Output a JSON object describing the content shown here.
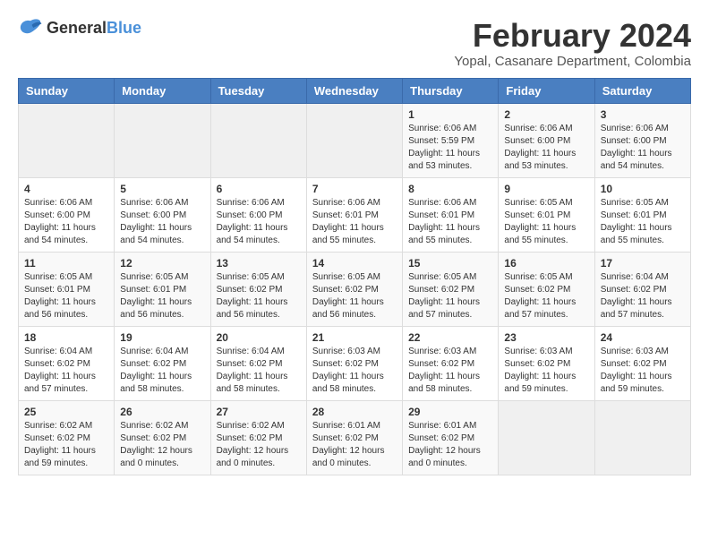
{
  "header": {
    "logo_general": "General",
    "logo_blue": "Blue",
    "month_year": "February 2024",
    "location": "Yopal, Casanare Department, Colombia"
  },
  "calendar": {
    "days_of_week": [
      "Sunday",
      "Monday",
      "Tuesday",
      "Wednesday",
      "Thursday",
      "Friday",
      "Saturday"
    ],
    "weeks": [
      [
        {
          "day": "",
          "info": ""
        },
        {
          "day": "",
          "info": ""
        },
        {
          "day": "",
          "info": ""
        },
        {
          "day": "",
          "info": ""
        },
        {
          "day": "1",
          "info": "Sunrise: 6:06 AM\nSunset: 5:59 PM\nDaylight: 11 hours and 53 minutes."
        },
        {
          "day": "2",
          "info": "Sunrise: 6:06 AM\nSunset: 6:00 PM\nDaylight: 11 hours and 53 minutes."
        },
        {
          "day": "3",
          "info": "Sunrise: 6:06 AM\nSunset: 6:00 PM\nDaylight: 11 hours and 54 minutes."
        }
      ],
      [
        {
          "day": "4",
          "info": "Sunrise: 6:06 AM\nSunset: 6:00 PM\nDaylight: 11 hours and 54 minutes."
        },
        {
          "day": "5",
          "info": "Sunrise: 6:06 AM\nSunset: 6:00 PM\nDaylight: 11 hours and 54 minutes."
        },
        {
          "day": "6",
          "info": "Sunrise: 6:06 AM\nSunset: 6:00 PM\nDaylight: 11 hours and 54 minutes."
        },
        {
          "day": "7",
          "info": "Sunrise: 6:06 AM\nSunset: 6:01 PM\nDaylight: 11 hours and 55 minutes."
        },
        {
          "day": "8",
          "info": "Sunrise: 6:06 AM\nSunset: 6:01 PM\nDaylight: 11 hours and 55 minutes."
        },
        {
          "day": "9",
          "info": "Sunrise: 6:05 AM\nSunset: 6:01 PM\nDaylight: 11 hours and 55 minutes."
        },
        {
          "day": "10",
          "info": "Sunrise: 6:05 AM\nSunset: 6:01 PM\nDaylight: 11 hours and 55 minutes."
        }
      ],
      [
        {
          "day": "11",
          "info": "Sunrise: 6:05 AM\nSunset: 6:01 PM\nDaylight: 11 hours and 56 minutes."
        },
        {
          "day": "12",
          "info": "Sunrise: 6:05 AM\nSunset: 6:01 PM\nDaylight: 11 hours and 56 minutes."
        },
        {
          "day": "13",
          "info": "Sunrise: 6:05 AM\nSunset: 6:02 PM\nDaylight: 11 hours and 56 minutes."
        },
        {
          "day": "14",
          "info": "Sunrise: 6:05 AM\nSunset: 6:02 PM\nDaylight: 11 hours and 56 minutes."
        },
        {
          "day": "15",
          "info": "Sunrise: 6:05 AM\nSunset: 6:02 PM\nDaylight: 11 hours and 57 minutes."
        },
        {
          "day": "16",
          "info": "Sunrise: 6:05 AM\nSunset: 6:02 PM\nDaylight: 11 hours and 57 minutes."
        },
        {
          "day": "17",
          "info": "Sunrise: 6:04 AM\nSunset: 6:02 PM\nDaylight: 11 hours and 57 minutes."
        }
      ],
      [
        {
          "day": "18",
          "info": "Sunrise: 6:04 AM\nSunset: 6:02 PM\nDaylight: 11 hours and 57 minutes."
        },
        {
          "day": "19",
          "info": "Sunrise: 6:04 AM\nSunset: 6:02 PM\nDaylight: 11 hours and 58 minutes."
        },
        {
          "day": "20",
          "info": "Sunrise: 6:04 AM\nSunset: 6:02 PM\nDaylight: 11 hours and 58 minutes."
        },
        {
          "day": "21",
          "info": "Sunrise: 6:03 AM\nSunset: 6:02 PM\nDaylight: 11 hours and 58 minutes."
        },
        {
          "day": "22",
          "info": "Sunrise: 6:03 AM\nSunset: 6:02 PM\nDaylight: 11 hours and 58 minutes."
        },
        {
          "day": "23",
          "info": "Sunrise: 6:03 AM\nSunset: 6:02 PM\nDaylight: 11 hours and 59 minutes."
        },
        {
          "day": "24",
          "info": "Sunrise: 6:03 AM\nSunset: 6:02 PM\nDaylight: 11 hours and 59 minutes."
        }
      ],
      [
        {
          "day": "25",
          "info": "Sunrise: 6:02 AM\nSunset: 6:02 PM\nDaylight: 11 hours and 59 minutes."
        },
        {
          "day": "26",
          "info": "Sunrise: 6:02 AM\nSunset: 6:02 PM\nDaylight: 12 hours and 0 minutes."
        },
        {
          "day": "27",
          "info": "Sunrise: 6:02 AM\nSunset: 6:02 PM\nDaylight: 12 hours and 0 minutes."
        },
        {
          "day": "28",
          "info": "Sunrise: 6:01 AM\nSunset: 6:02 PM\nDaylight: 12 hours and 0 minutes."
        },
        {
          "day": "29",
          "info": "Sunrise: 6:01 AM\nSunset: 6:02 PM\nDaylight: 12 hours and 0 minutes."
        },
        {
          "day": "",
          "info": ""
        },
        {
          "day": "",
          "info": ""
        }
      ]
    ]
  }
}
